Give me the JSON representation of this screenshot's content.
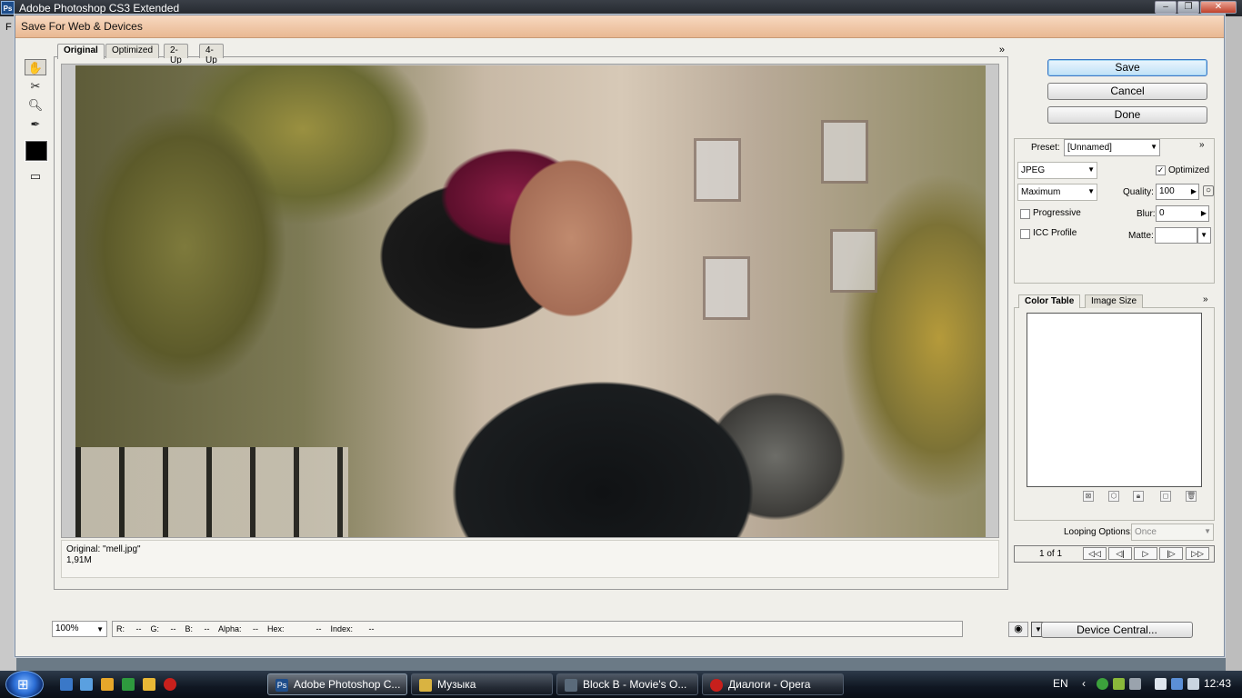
{
  "app": {
    "title": "Adobe Photoshop CS3 Extended",
    "logo": "Ps",
    "behind_menu": "F"
  },
  "dialog": {
    "title": "Save For Web & Devices",
    "tabs": [
      "Original",
      "Optimized",
      "2-Up",
      "4-Up"
    ],
    "active_tab": "Original",
    "expand": "»",
    "info_line1": "Original: \"mell.jpg\"",
    "info_line2": "1,91M"
  },
  "buttons": {
    "save": "Save",
    "cancel": "Cancel",
    "done": "Done",
    "device_central": "Device Central..."
  },
  "settings": {
    "preset_label": "Preset:",
    "preset_value": "[Unnamed]",
    "format": "JPEG",
    "quality_level": "Maximum",
    "optimized_label": "Optimized",
    "optimized_checked": true,
    "quality_label": "Quality:",
    "quality_value": "100",
    "progressive_label": "Progressive",
    "blur_label": "Blur:",
    "blur_value": "0",
    "icc_label": "ICC Profile",
    "matte_label": "Matte:",
    "expand": "»"
  },
  "color_panel": {
    "tabs": [
      "Color Table",
      "Image Size"
    ],
    "active_tab": "Color Table",
    "expand": "»",
    "looping_label": "Looping Options:",
    "looping_value": "Once",
    "frame_counter": "1 of 1"
  },
  "status": {
    "zoom": "100%",
    "readout": "R:     --    G:     --    B:     --    Alpha:     --    Hex:              --    Index:       --"
  },
  "taskbar": {
    "tasks": [
      {
        "label": "Adobe Photoshop C...",
        "icon": "Ps",
        "color": "#1e4d8a"
      },
      {
        "label": "Музыка",
        "icon": "folder-icon",
        "color": "#d9b341"
      },
      {
        "label": "Block B - Movie's O...",
        "icon": "media-icon",
        "color": "#5a6a7a"
      },
      {
        "label": "Диалоги - Opera",
        "icon": "opera-icon",
        "color": "#c8201c"
      }
    ],
    "lang": "EN",
    "clock": "12:43"
  }
}
